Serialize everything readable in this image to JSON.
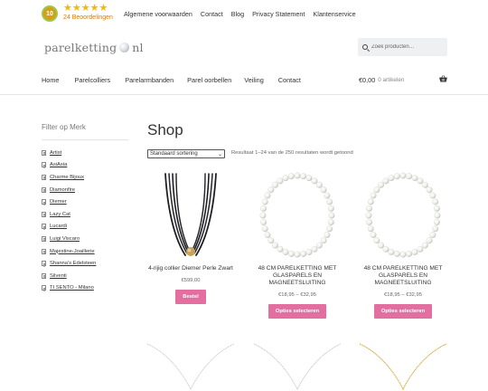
{
  "rating": {
    "score": "10",
    "stars": "★★★★★",
    "reviews": "24 Beoordelingen"
  },
  "top_nav": [
    "Algemene voorwaarden",
    "Contact",
    "Blog",
    "Privacy Statement",
    "Klantenservice"
  ],
  "logo": {
    "left": "parelketting",
    "right": "nl"
  },
  "search": {
    "placeholder": "Zoek producten…"
  },
  "main_nav": [
    "Home",
    "Parelcolliers",
    "Parelarmbanden",
    "Parel oorbellen",
    "Veiling",
    "Contact"
  ],
  "cart": {
    "amount": "€0,00",
    "count": "0 artikelen"
  },
  "sidebar": {
    "title": "Filter op Merk",
    "brands": [
      "Artist",
      "AsiAsia",
      "Charme Bijoux",
      "Diamonfire",
      "Diemer",
      "Lazy Cat",
      "Lucardi",
      "Luigi Viscaro",
      "Majestine-Joaillerie",
      "Shanna's Edelsteen",
      "Silventi",
      "TI SENTO - Milano"
    ]
  },
  "shop": {
    "title": "Shop",
    "sort_selected": "Standaard sortering",
    "result_text": "Resultaat 1–24 van de 250 resultaten wordt getoond"
  },
  "products": [
    {
      "name": "4-rijig collier Diemer Perle Zwart",
      "price": "€599,00",
      "button": "Bestel"
    },
    {
      "name": "48 CM PARELKETTING MET GLASPARELS EN MAGNEETSLUITING",
      "price": "€18,95 – €32,95",
      "button": "Opties selecteren"
    },
    {
      "name": "48 CM PARELKETTING MET GLASPARELS EN MAGNEETSLUITING",
      "price": "€18,95 – €32,95",
      "button": "Opties selecteren"
    }
  ],
  "colors": {
    "accent": "#e26f9f",
    "star": "#f5b800",
    "badge": "#d4a017"
  }
}
